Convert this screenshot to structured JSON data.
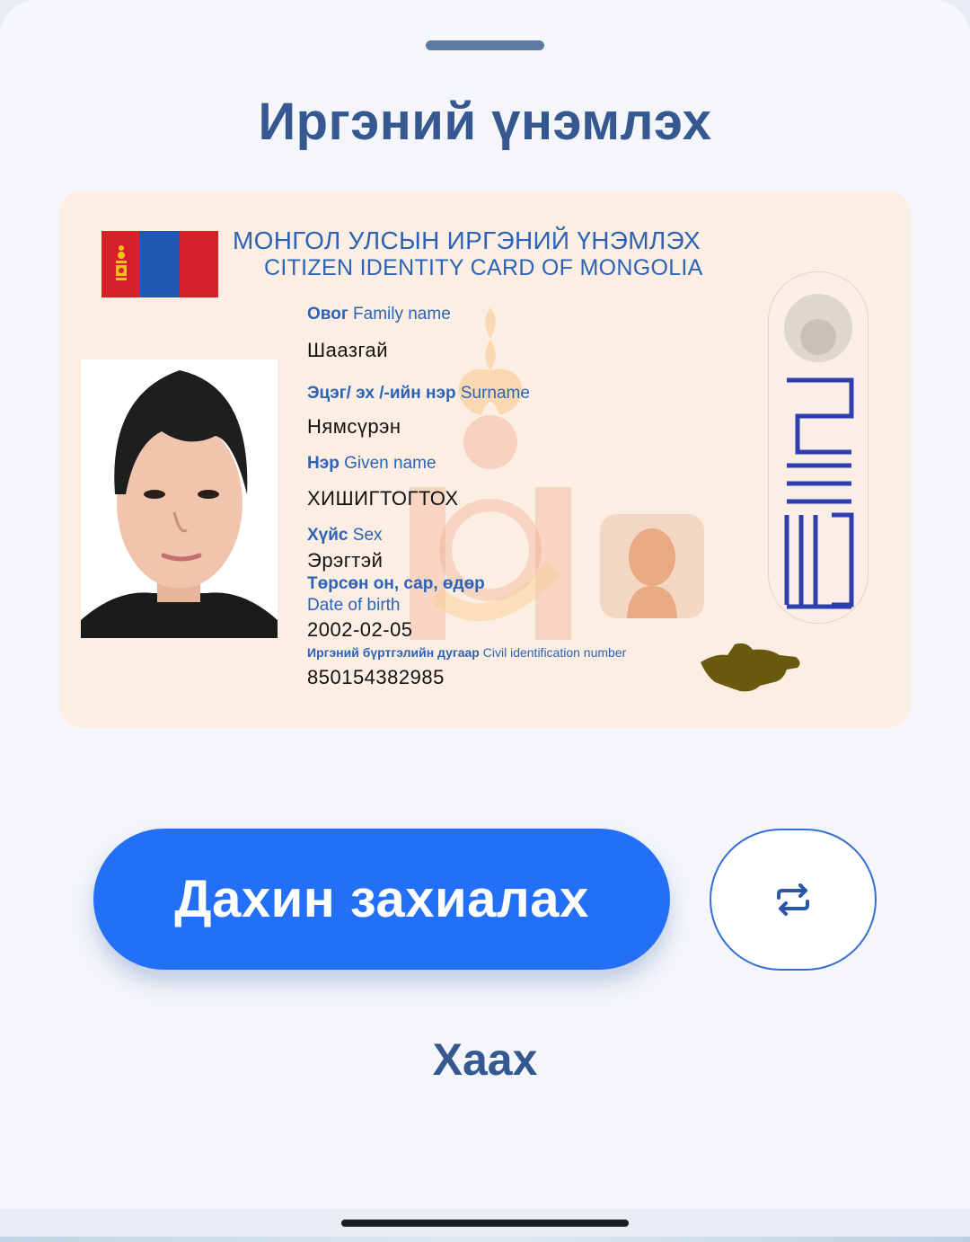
{
  "sheet": {
    "title": "Иргэний үнэмлэх"
  },
  "card": {
    "header_mn": "МОНГОЛ УЛСЫН ИРГЭНИЙ ҮНЭМЛЭХ",
    "header_en": "CITIZEN IDENTITY CARD OF MONGOLIA",
    "family_name_label_mn": "Овог",
    "family_name_label_en": "Family name",
    "family_name": "Шаазгай",
    "surname_label_mn": "Эцэг/ эх /-ийн нэр",
    "surname_label_en": "Surname",
    "surname": "Нямсүрэн",
    "given_name_label_mn": "Нэр",
    "given_name_label_en": "Given name",
    "given_name": "ХИШИГТОГТОХ",
    "sex_label_mn": "Хүйс",
    "sex_label_en": "Sex",
    "sex": "Эрэгтэй",
    "dob_label_mn": "Төрсөн он, сар, өдөр",
    "dob_label_en": "Date of birth",
    "dob": "2002-02-05",
    "civil_id_label_mn": "Иргэний бүртгэлийн дугаар",
    "civil_id_label_en": "Civil identification number",
    "civil_id": "850154382985"
  },
  "actions": {
    "reorder_label": "Дахин захиалах",
    "close_label": "Хаах"
  },
  "icons": {
    "swap": "swap-arrows-icon",
    "flag": "mongolia-flag-icon",
    "map": "mongolia-map-icon"
  },
  "colors": {
    "primary": "#236ff8",
    "heading": "#34588f",
    "card_bg": "#fdeee3",
    "card_text": "#2c63b6"
  }
}
